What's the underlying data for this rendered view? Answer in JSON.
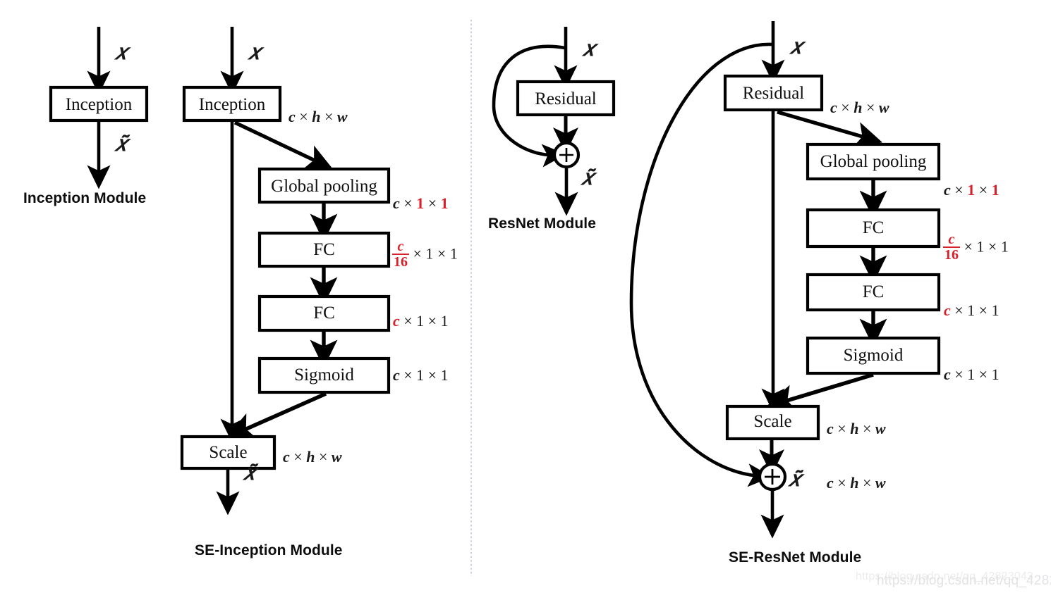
{
  "figure": {
    "type": "diagram",
    "description": "Squeeze-and-Excitation block integrations: Inception / SE-Inception and ResNet / SE-ResNet modules",
    "background_color": "#ffffff",
    "accent_color": "#d9202a",
    "line_color": "#000000"
  },
  "panels": {
    "left": {
      "divider": "vertical-dotted-line",
      "inception_module": {
        "title": "Inception Module",
        "input_symbol": "𝑥",
        "output_symbol": "𝑥̃",
        "blocks": [
          {
            "label": "Inception"
          }
        ]
      },
      "se_inception_module": {
        "title": "SE-Inception Module",
        "input_symbol": "𝑥",
        "output_symbol": "𝑥̃",
        "blocks": [
          {
            "label": "Inception",
            "dim": "c × h × w"
          },
          {
            "label": "Global pooling",
            "dim": "c × 1 × 1"
          },
          {
            "label": "FC",
            "dim": "c/16 × 1 × 1"
          },
          {
            "label": "FC",
            "dim": "c × 1 × 1"
          },
          {
            "label": "Sigmoid",
            "dim": "c × 1 × 1"
          },
          {
            "label": "Scale",
            "dim": "c × h × w"
          }
        ]
      }
    },
    "right": {
      "resnet_module": {
        "title": "ResNet Module",
        "input_symbol": "𝑥",
        "output_symbol": "𝑥̃",
        "sum_symbol": "+",
        "blocks": [
          {
            "label": "Residual"
          }
        ]
      },
      "se_resnet_module": {
        "title": "SE-ResNet Module",
        "input_symbol": "𝑥",
        "output_symbol": "𝑥̃",
        "sum_symbol": "+",
        "blocks": [
          {
            "label": "Residual",
            "dim": "c × h × w"
          },
          {
            "label": "Global pooling",
            "dim": "c × 1 × 1"
          },
          {
            "label": "FC",
            "dim": "c/16 × 1 × 1"
          },
          {
            "label": "FC",
            "dim": "c × 1 × 1"
          },
          {
            "label": "Sigmoid",
            "dim": "c × 1 × 1"
          },
          {
            "label": "Scale",
            "dim": "c × h × w"
          },
          {
            "label": "sum-output",
            "dim": "c × h × w"
          }
        ]
      }
    }
  },
  "watermark": {
    "text": "https://blog.csdn.net/qq_42823043",
    "text_secondary": "https://blog.csdn.net/qq_42823043"
  }
}
